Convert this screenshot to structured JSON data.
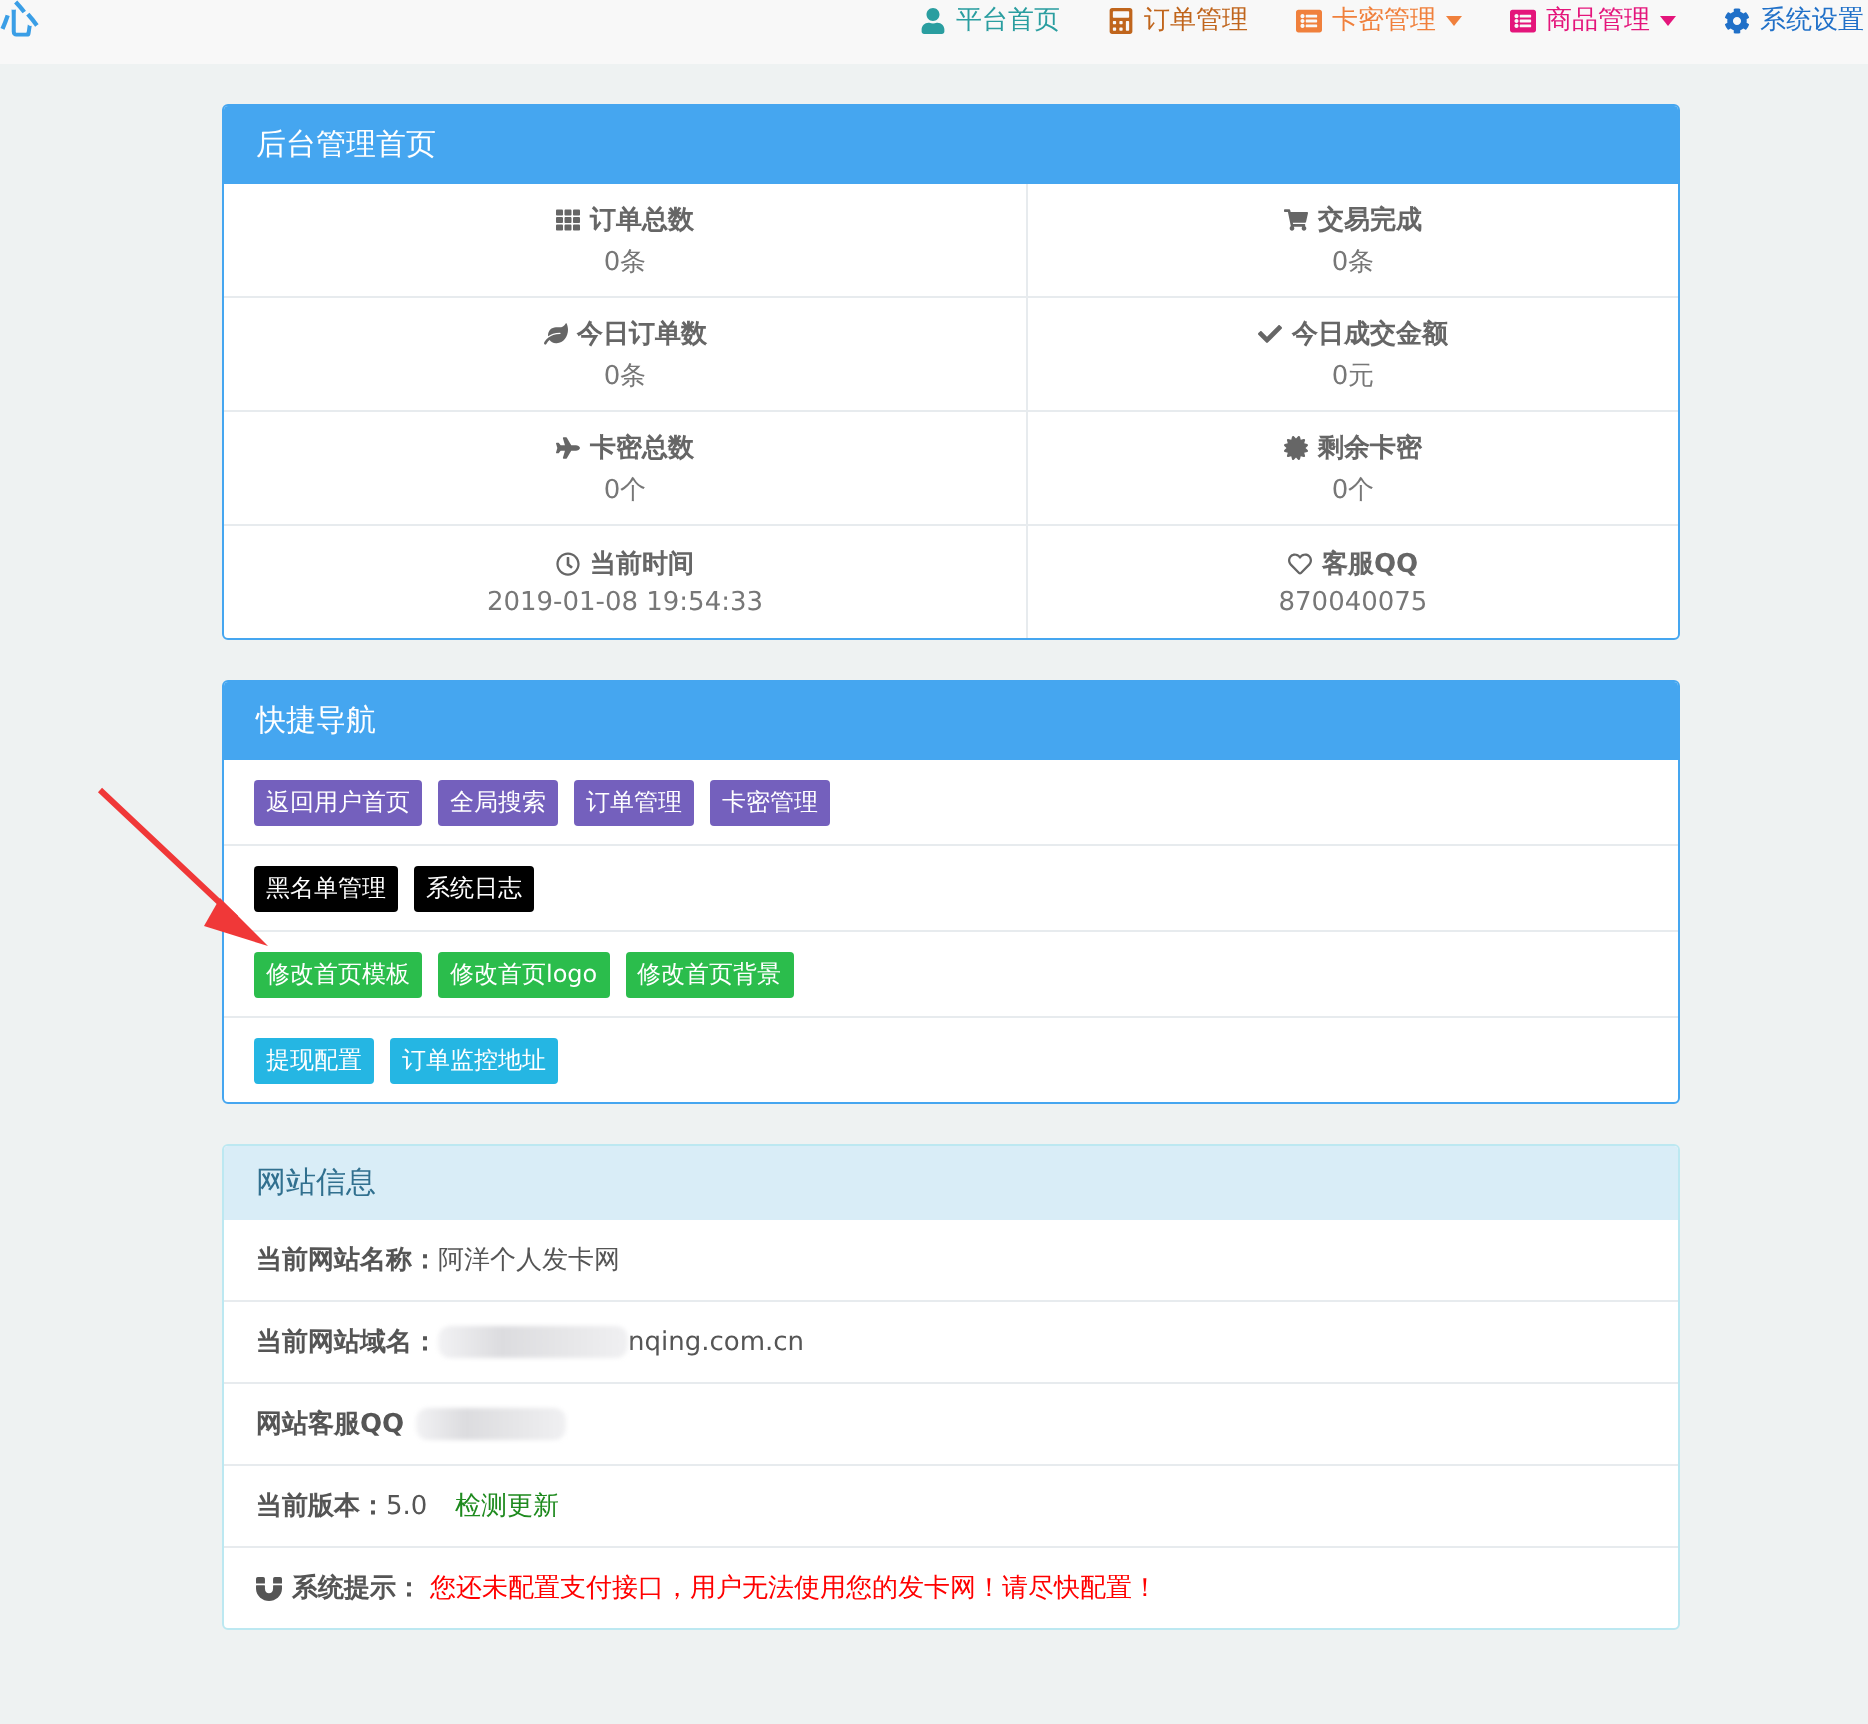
{
  "brand": "心",
  "nav": [
    {
      "label": "平台首页",
      "color": "#2a9ea0",
      "dropdown": false
    },
    {
      "label": "订单管理",
      "color": "#c0651c",
      "dropdown": false
    },
    {
      "label": "卡密管理",
      "color": "#f0803c",
      "dropdown": true
    },
    {
      "label": "商品管理",
      "color": "#e4157b",
      "dropdown": true
    },
    {
      "label": "系统设置",
      "color": "#2070c8",
      "dropdown": false
    }
  ],
  "dashboard": {
    "title": "后台管理首页",
    "stats": [
      {
        "label": "订单总数",
        "value": "0条"
      },
      {
        "label": "交易完成",
        "value": "0条"
      },
      {
        "label": "今日订单数",
        "value": "0条"
      },
      {
        "label": "今日成交金额",
        "value": "0元"
      },
      {
        "label": "卡密总数",
        "value": "0个"
      },
      {
        "label": "剩余卡密",
        "value": "0个"
      },
      {
        "label": "当前时间",
        "value": "2019-01-08 19:54:33"
      },
      {
        "label": "客服QQ",
        "value": "870040075"
      }
    ]
  },
  "quick_nav": {
    "title": "快捷导航",
    "groups": [
      {
        "color": "#7460bd",
        "buttons": [
          "返回用户首页",
          "全局搜索",
          "订单管理",
          "卡密管理"
        ]
      },
      {
        "color": "#000000",
        "buttons": [
          "黑名单管理",
          "系统日志"
        ]
      },
      {
        "color": "#2bbd4c",
        "buttons": [
          "修改首页模板",
          "修改首页logo",
          "修改首页背景"
        ]
      },
      {
        "color": "#25b6e3",
        "buttons": [
          "提现配置",
          "订单监控地址"
        ]
      }
    ]
  },
  "site_info": {
    "title": "网站信息",
    "rows": [
      {
        "kind": "text",
        "label": "当前网站名称：",
        "value": "阿洋个人发卡网"
      },
      {
        "kind": "blurred",
        "label": "当前网站域名：",
        "value": "nqing.com.cn"
      },
      {
        "kind": "blurred",
        "label": "网站客服QQ"
      },
      {
        "kind": "version",
        "label": "当前版本：",
        "value": "5.0",
        "link": "检测更新"
      },
      {
        "kind": "notice",
        "label": "系统提示：",
        "value": "您还未配置支付接口，用户无法使用您的发卡网！请尽快配置！"
      }
    ]
  }
}
